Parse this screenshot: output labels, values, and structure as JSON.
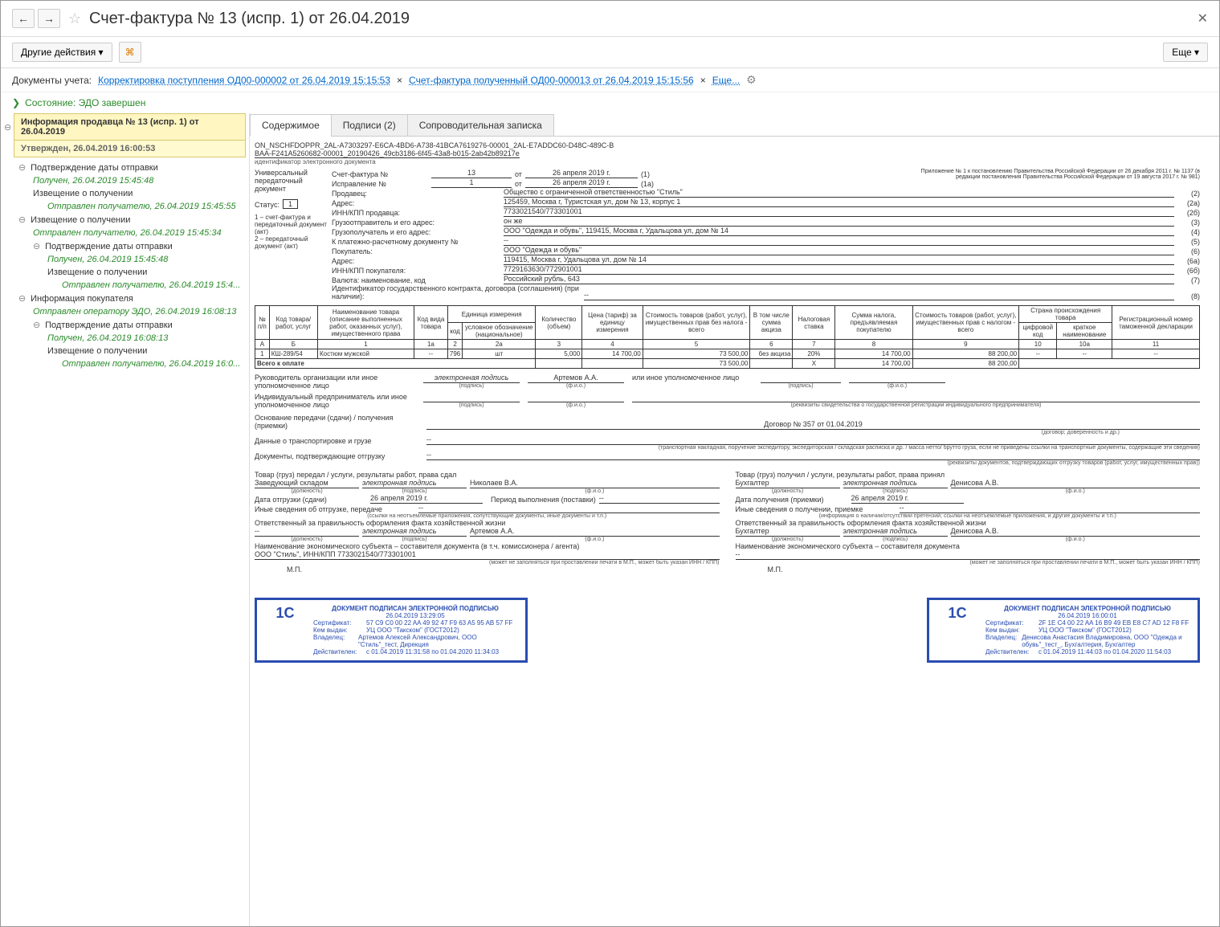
{
  "header": {
    "title": "Счет-фактура № 13 (испр. 1) от 26.04.2019"
  },
  "toolbar": {
    "other_actions": "Другие действия",
    "more": "Еще"
  },
  "docline": {
    "label": "Документы учета:",
    "link1": "Корректировка поступления ОД00-000002 от 26.04.2019 15:15:53",
    "link2": "Счет-фактура полученный ОД00-000013 от 26.04.2019 15:15:56",
    "more": "Еще..."
  },
  "state": {
    "label": "Состояние: ЭДО завершен"
  },
  "sidebar": {
    "head": "Информация продавца № 13 (испр. 1) от 26.04.2019",
    "sub": "Утвержден, 26.04.2019 16:00:53",
    "items": [
      {
        "lvl": 1,
        "exp": "⊖",
        "text": "Подтверждение даты отправки"
      },
      {
        "lvl": 2,
        "green": true,
        "text": "Получен, 26.04.2019 15:45:48"
      },
      {
        "lvl": 2,
        "text": "Извещение о получении"
      },
      {
        "lvl": 3,
        "green": true,
        "text": "Отправлен получателю, 26.04.2019 15:45:55"
      },
      {
        "lvl": 1,
        "exp": "⊖",
        "text": "Извещение о получении"
      },
      {
        "lvl": 2,
        "green": true,
        "text": "Отправлен получателю, 26.04.2019 15:45:34"
      },
      {
        "lvl": 2,
        "exp": "⊖",
        "text": "Подтверждение даты отправки"
      },
      {
        "lvl": 3,
        "green": true,
        "text": "Получен, 26.04.2019 15:45:48"
      },
      {
        "lvl": 3,
        "text": "Извещение о получении"
      },
      {
        "lvl": 4,
        "green": true,
        "text": "Отправлен получателю, 26.04.2019 15:4..."
      },
      {
        "lvl": 1,
        "exp": "⊖",
        "text": "Информация покупателя"
      },
      {
        "lvl": 2,
        "green": true,
        "text": "Отправлен оператору ЭДО, 26.04.2019 16:08:13"
      },
      {
        "lvl": 2,
        "exp": "⊖",
        "text": "Подтверждение даты отправки"
      },
      {
        "lvl": 3,
        "green": true,
        "text": "Получен, 26.04.2019 16:08:13"
      },
      {
        "lvl": 3,
        "text": "Извещение о получении"
      },
      {
        "lvl": 4,
        "green": true,
        "text": "Отправлен получателю, 26.04.2019 16:0..."
      }
    ]
  },
  "tabs": [
    "Содержимое",
    "Подписи (2)",
    "Сопроводительная записка"
  ],
  "doc": {
    "file_line1": "ON_NSCHFDOPPR_2AL-A7303297-E6CA-4BD6-A738-41BCA7619276-00001_2AL-E7ADDC60-D48C-489C-B",
    "file_line2": "BAA-F241A5260682-00001_20190426_49cb3186-6f45-43a8-b015-2ab42b89217e",
    "file_sub": "идентификатор электронного документа",
    "left_block": {
      "l1": "Универсальный передаточный документ",
      "status_lbl": "Статус:",
      "status_val": "1",
      "note1": "1 – счет-фактура и передаточный документ (акт)",
      "note2": "2 – передаточный документ (акт)"
    },
    "right_note": "Приложение № 1 к постановлению Правительства Российской Федерации от 26 декабря 2011 г. № 1137 (в редакции постановления Правительства Российской Федерации от 19 августа 2017 г. № 981)",
    "rows": {
      "sf_lbl": "Счет-фактура №",
      "sf_no": "13",
      "sf_from": "от",
      "sf_date": "26 апреля 2019 г.",
      "sf_code": "(1)",
      "isp_lbl": "Исправление №",
      "isp_no": "1",
      "isp_from": "от",
      "isp_date": "26 апреля 2019 г.",
      "isp_code": "(1а)",
      "seller_lbl": "Продавец:",
      "seller_val": "Общество с ограниченной ответственностью \"Стиль\"",
      "seller_code": "(2)",
      "addr_lbl": "Адрес:",
      "addr_val": "125459, Москва г, Туристская ул, дом № 13, корпус 1",
      "addr_code": "(2а)",
      "inn_lbl": "ИНН/КПП продавца:",
      "inn_val": "7733021540/773301001",
      "inn_code": "(2б)",
      "shipper_lbl": "Грузоотправитель и его адрес:",
      "shipper_val": "он же",
      "shipper_code": "(3)",
      "consignee_lbl": "Грузополучатель и его адрес:",
      "consignee_val": "ООО \"Одежда и обувь\", 119415, Москва г, Удальцова ул, дом № 14",
      "consignee_code": "(4)",
      "paydoc_lbl": "К платежно-расчетному документу №",
      "paydoc_val": "--",
      "paydoc_code": "(5)",
      "buyer_lbl": "Покупатель:",
      "buyer_val": "ООО \"Одежда и обувь\"",
      "buyer_code": "(6)",
      "buyer_addr_lbl": "Адрес:",
      "buyer_addr_val": "119415, Москва г, Удальцова ул, дом № 14",
      "buyer_addr_code": "(6а)",
      "buyer_inn_lbl": "ИНН/КПП покупателя:",
      "buyer_inn_val": "7729163630/772901001",
      "buyer_inn_code": "(6б)",
      "currency_lbl": "Валюта: наименование, код",
      "currency_val": "Российский рубль, 643",
      "currency_code": "(7)",
      "gosid_lbl": "Идентификатор государственного контракта, договора (соглашения) (при наличии):",
      "gosid_val": "--",
      "gosid_code": "(8)"
    },
    "table": {
      "h": [
        "№ п/п",
        "Код товара/ работ, услуг",
        "Наименование товара (описание выполненных работ, оказанных услуг), имущественного права",
        "Код вида товара",
        "Единица измерения",
        "",
        "Количество (объем)",
        "Цена (тариф) за единицу измерения",
        "Стоимость товаров (работ, услуг), имущественных прав без налога - всего",
        "В том числе сумма акциза",
        "Налоговая ставка",
        "Сумма налога, предъявляемая покупателю",
        "Стоимость товаров (работ, услуг), имущественных прав с налогом - всего",
        "Страна происхождения товара",
        "",
        "Регистрационный номер таможенной декларации"
      ],
      "sub1": "условное обозначение (национальное)",
      "sub0": "код",
      "sub13": "цифровой код",
      "sub14": "краткое наименование",
      "nums": [
        "А",
        "Б",
        "1",
        "1а",
        "2",
        "2а",
        "3",
        "4",
        "5",
        "6",
        "7",
        "8",
        "9",
        "10",
        "10а",
        "11"
      ],
      "row": {
        "n": "1",
        "code": "КШ-289/54",
        "name": "Костюм мужской",
        "kind": "--",
        "ucode": "796",
        "uname": "шт",
        "qty": "5,000",
        "price": "14 700,00",
        "sum_no_tax": "73 500,00",
        "excise": "без акциза",
        "rate": "20%",
        "tax": "14 700,00",
        "total": "88 200,00",
        "ccode": "--",
        "cname": "--",
        "decl": "--"
      },
      "total_lbl": "Всего к оплате",
      "total_sum_notax": "73 500,00",
      "total_x": "Х",
      "total_tax": "14 700,00",
      "total_all": "88 200,00"
    },
    "sig_section": {
      "head_org": "Руководитель организации или иное уполномоченное лицо",
      "e_sign1": "электронная подпись",
      "fio1": "Артемов А.А.",
      "other": "или иное уполномоченное лицо",
      "ip": "Индивидуальный предприниматель или иное уполномоченное лицо",
      "podpis": "(подпись)",
      "fio": "(ф.и.о.)",
      "rekv": "(реквизиты свидетельства о государственной регистрации индивидуального предпринимателя)"
    },
    "basis_lbl": "Основание передачи (сдачи) / получения (приемки)",
    "basis_val": "Договор № 357 от 01.04.2019",
    "basis_sub": "(договор; доверенность и др.)",
    "transport_lbl": "Данные о транспортировке и грузе",
    "transport_val": "--",
    "transport_sub": "(транспортная накладная, поручение экспедитору, экспедиторская / складская расписка и др. / масса нетто/ брутто груза, если не приведены ссылки на транспортные документы, содержащие эти сведения)",
    "confirm_lbl": "Документы, подтверждающие отгрузку",
    "confirm_val": "--",
    "confirm_sub": "(реквизиты документов, подтверждающих отгрузку товаров (работ, услуг, имущественных прав))",
    "left_col": {
      "l1": "Товар (груз) передал / услуги, результаты работ, права сдал",
      "post": "Заведующий складом",
      "sig": "электронная подпись",
      "fio": "Николаев В.А.",
      "date_lbl": "Дата отгрузки (сдачи)",
      "date": "26 апреля 2019 г.",
      "period_lbl": "Период выполнения (поставки)",
      "period": "--",
      "other_lbl": "Иные сведения об отгрузке, передаче",
      "other": "--",
      "other_sub": "(ссылки на неотъемлемые приложения, сопутствующие документы, иные документы и т.п.)",
      "resp_lbl": "Ответственный за правильность оформления факта хозяйственной жизни",
      "resp_post": "--",
      "resp_sig": "электронная подпись",
      "resp_fio": "Артемов А.А.",
      "econ_lbl": "Наименование экономического субъекта – составителя документа (в т.ч. комиссионера / агента)",
      "econ": "ООО \"Стиль\", ИНН/КПП 7733021540/773301001",
      "mp": "М.П.",
      "mp_sub": "(может не заполняться при проставлении печати в М.П., может быть указан ИНН / КПП)"
    },
    "right_col": {
      "l1": "Товар (груз) получил / услуги, результаты работ, права принял",
      "post": "Бухгалтер",
      "sig": "электронная подпись",
      "fio": "Денисова А.В.",
      "date_lbl": "Дата получения (приемки)",
      "date": "26 апреля 2019 г.",
      "other_lbl": "Иные сведения о получении, приемке",
      "other": "--",
      "other_sub": "(информация о наличии/отсутствии претензий; ссылки на неотъемлемые приложения, и другие документы и т.п.)",
      "resp_lbl": "Ответственный за правильность оформления факта хозяйственной жизни",
      "resp_post": "Бухгалтер",
      "resp_sig": "электронная подпись",
      "resp_fio": "Денисова А.В.",
      "econ_lbl": "Наименование экономического субъекта – составителя документа",
      "econ": "--",
      "mp": "М.П.",
      "mp_sub": "(может не заполняться при проставлении печати в М.П., может быть указан ИНН / КПП)"
    },
    "sig_stamp1": {
      "title": "ДОКУМЕНТ ПОДПИСАН ЭЛЕКТРОННОЙ ПОДПИСЬЮ",
      "date": "26.04.2019 13:29:05",
      "cert_lbl": "Сертификат:",
      "cert": "57 C9 C0 00 22 AA 49 92 47 F9 63 A5 95 AB 57 FF",
      "issuer_lbl": "Кем выдан:",
      "issuer": "УЦ ООО \"Такском\" (ГОСТ2012)",
      "owner_lbl": "Владелец:",
      "owner": "Артемов Алексей Александрович, ООО \"Стиль\"_тест, Дирекция",
      "valid_lbl": "Действителен:",
      "valid": "с 01.04.2019 11:31:58 по 01.04.2020 11:34:03"
    },
    "sig_stamp2": {
      "title": "ДОКУМЕНТ ПОДПИСАН ЭЛЕКТРОННОЙ ПОДПИСЬЮ",
      "date": "26.04.2019 16:00:01",
      "cert_lbl": "Сертификат:",
      "cert": "2F 1E C4 00 22 AA 16 B9 49 EB E8 C7 AD 12 F8 FF",
      "issuer_lbl": "Кем выдан:",
      "issuer": "УЦ ООО \"Такском\" (ГОСТ2012)",
      "owner_lbl": "Владелец:",
      "owner": "Денисова Анастасия Владимировна, ООО \"Одежда и обувь\"_тест_, Бухгалтерия, Бухгалтер",
      "valid_lbl": "Действителен:",
      "valid": "с 01.04.2019 11:44:03 по 01.04.2020 11:54:03"
    },
    "post_tiny": "(должность)",
    "fio_tiny": "(ф.и.о.)"
  }
}
